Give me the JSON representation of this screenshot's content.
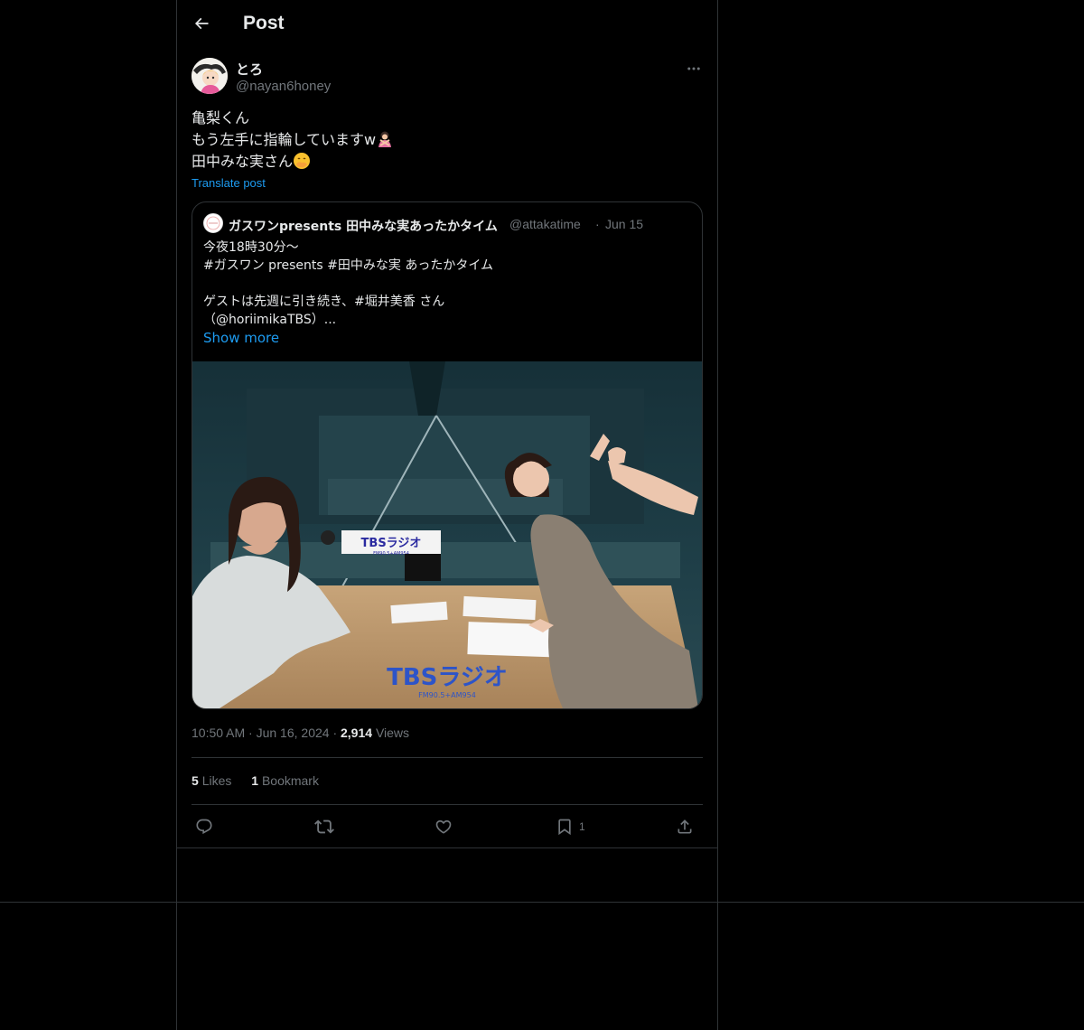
{
  "header": {
    "title": "Post"
  },
  "post": {
    "author_name": "とろ",
    "author_handle": "@nayan6honey",
    "lines": [
      "亀梨くん",
      "もう左手に指輪していますw",
      "田中みな実さん"
    ],
    "translate_label": "Translate post",
    "timestamp": "10:50 AM · Jun 16, 2024 ·",
    "views_count": "2,914",
    "views_label": "Views",
    "likes_count": "5",
    "likes_label": "Likes",
    "bookmarks_count": "1",
    "bookmarks_label": "Bookmark"
  },
  "quote": {
    "name": "ガスワンpresents 田中みな実あったかタイム",
    "handle": "@attakatime",
    "date": "Jun 15",
    "separator": "·",
    "lines": [
      "今夜18時30分〜",
      "#ガスワン presents #田中みな実 あったかタイム",
      "",
      "ゲストは先週に引き続き、#堀井美香 さん",
      "（@horiimikaTBS）..."
    ],
    "show_more": "Show more",
    "image_sign_text": "TBSラジオ",
    "image_sign_sub": "FM90.5+AM954"
  },
  "actions": {
    "reply_icon": "reply-icon",
    "repost_icon": "repost-icon",
    "like_icon": "heart-icon",
    "bookmark_icon": "bookmark-icon",
    "bookmark_count": "1",
    "share_icon": "share-icon"
  },
  "colors": {
    "background": "#000000",
    "text": "#e7e9ea",
    "muted": "#71767b",
    "link": "#1d9bf0",
    "border": "#2f3336"
  }
}
